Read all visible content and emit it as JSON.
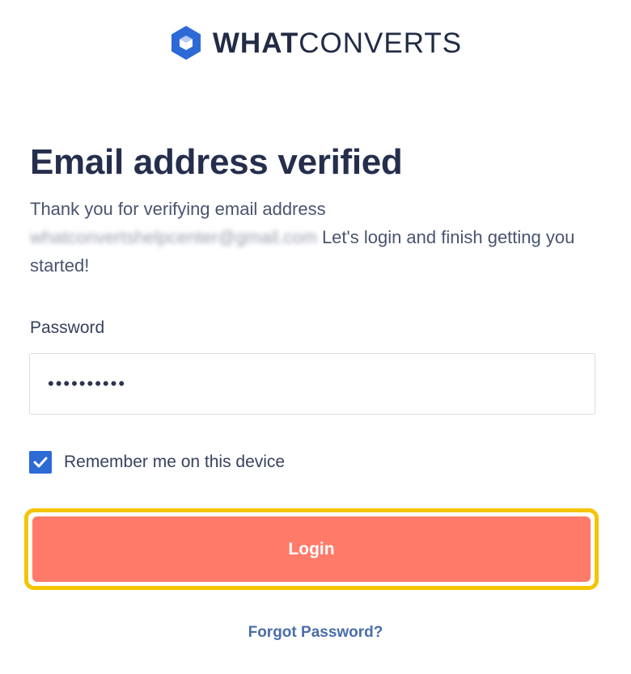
{
  "logo": {
    "bold_text": "WHAT",
    "light_text": "CONVERTS",
    "icon": "whatconverts-hexagon-logo",
    "color": "#2d6ad6"
  },
  "heading": "Email address verified",
  "intro": {
    "before_email": "Thank you for verifying email address",
    "email_blurred": "whatconvertshelpcenter@gmail.com",
    "after_email": "Let's login and finish getting you started!"
  },
  "password": {
    "label": "Password",
    "value": "••••••••••"
  },
  "remember": {
    "label": "Remember me on this device",
    "checked": true,
    "icon": "checkmark-icon"
  },
  "login_button": {
    "label": "Login",
    "color": "#ff7b69",
    "highlight_color": "#f5c400"
  },
  "forgot_link": "Forgot Password?"
}
